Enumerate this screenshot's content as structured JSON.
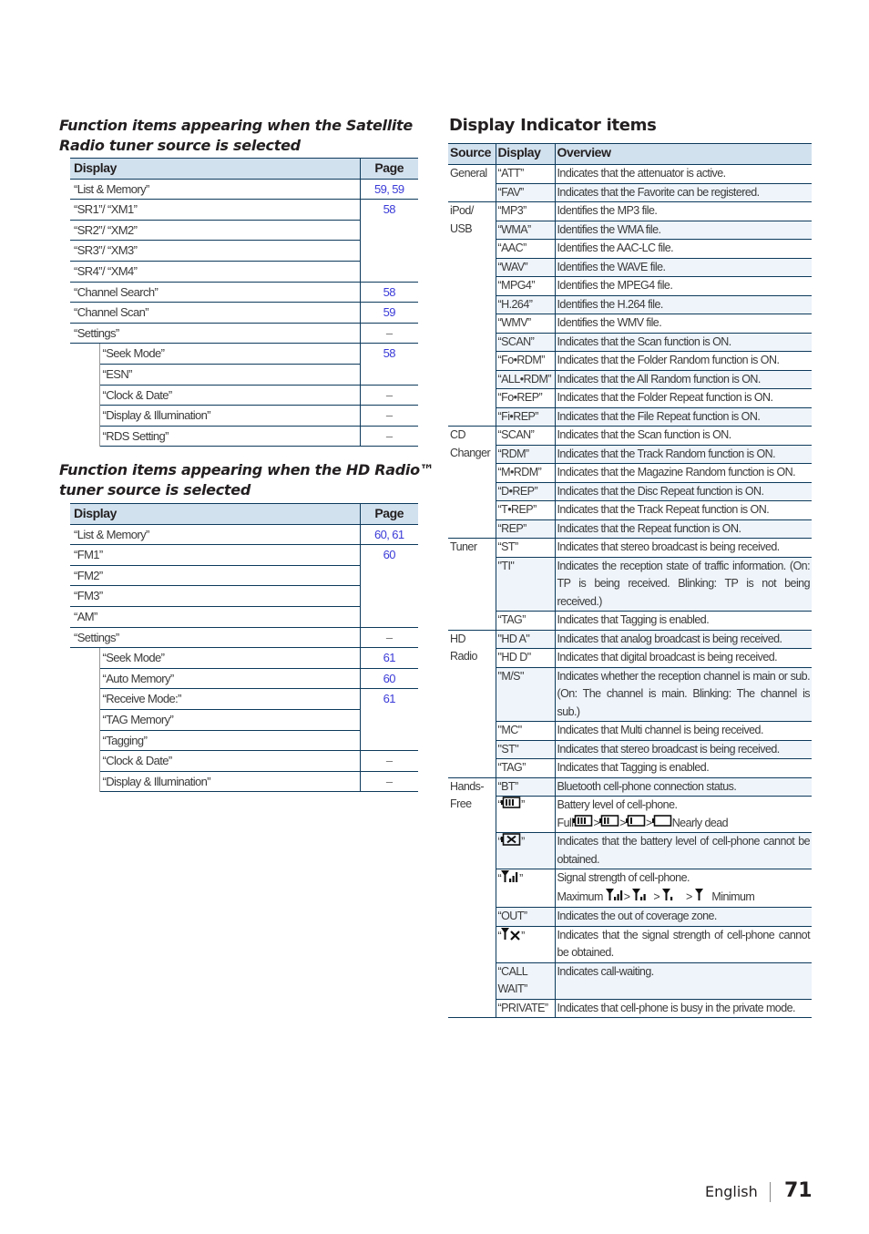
{
  "satellite_section": {
    "title_line1": "Function items appearing when the Satellite",
    "title_line2": "Radio tuner source is selected",
    "header": {
      "display": "Display",
      "page": "Page"
    },
    "rows": [
      {
        "display": "“List & Memory”",
        "page": "59, 59",
        "indent": false
      },
      {
        "display": "“SR1”/ “XM1”",
        "page": "58",
        "indent": false
      },
      {
        "display": "“SR2”/ “XM2”",
        "page": "",
        "indent": false
      },
      {
        "display": "“SR3”/ “XM3”",
        "page": "",
        "indent": false
      },
      {
        "display": "“SR4”/ “XM4”",
        "page": "",
        "indent": false
      },
      {
        "display": "“Channel Search”",
        "page": "58",
        "indent": false
      },
      {
        "display": "“Channel Scan”",
        "page": "59",
        "indent": false
      },
      {
        "display": "“Settings”",
        "page": "–",
        "indent": false
      },
      {
        "display": "“Seek Mode”",
        "page": "58",
        "indent": true
      },
      {
        "display": "“ESN”",
        "page": "",
        "indent": true
      },
      {
        "display": "“Clock & Date”",
        "page": "–",
        "indent": true
      },
      {
        "display": "“Display & Illumination”",
        "page": "–",
        "indent": true
      },
      {
        "display": "“RDS Setting”",
        "page": "–",
        "indent": true
      }
    ]
  },
  "hd_section": {
    "title_line1": "Function items appearing when the HD Radio™",
    "title_line2": "tuner source is selected",
    "header": {
      "display": "Display",
      "page": "Page"
    },
    "rows": [
      {
        "display": "“List & Memory”",
        "page": "60, 61",
        "indent": false
      },
      {
        "display": "“FM1”",
        "page": "60",
        "indent": false
      },
      {
        "display": "“FM2”",
        "page": "",
        "indent": false
      },
      {
        "display": "“FM3”",
        "page": "",
        "indent": false
      },
      {
        "display": "“AM”",
        "page": "",
        "indent": false
      },
      {
        "display": "“Settings”",
        "page": "–",
        "indent": false
      },
      {
        "display": "“Seek Mode”",
        "page": "61",
        "indent": true
      },
      {
        "display": "“Auto Memory”",
        "page": "60",
        "indent": true
      },
      {
        "display": "“Receive Mode:”",
        "page": "61",
        "indent": true
      },
      {
        "display": "“TAG Memory”",
        "page": "",
        "indent": true
      },
      {
        "display": "“Tagging”",
        "page": "",
        "indent": true
      },
      {
        "display": "“Clock & Date”",
        "page": "–",
        "indent": true
      },
      {
        "display": "“Display & Illumination”",
        "page": "–",
        "indent": true
      }
    ]
  },
  "indicator_section": {
    "title": "Display Indicator items",
    "header": {
      "source": "Source",
      "display": "Display",
      "overview": "Overview"
    },
    "rows": [
      {
        "source": "General",
        "display": "“ATT”",
        "overview": "Indicates that the attenuator is active."
      },
      {
        "source": "",
        "display": "“FAV”",
        "overview": "Indicates that the Favorite can be registered."
      },
      {
        "source": "iPod/ USB",
        "display": "“MP3”",
        "overview": "Identifies the MP3 file."
      },
      {
        "source": "",
        "display": "“WMA”",
        "overview": "Identifies the WMA file."
      },
      {
        "source": "",
        "display": "“AAC”",
        "overview": "Identifies the AAC-LC file."
      },
      {
        "source": "",
        "display": "“WAV”",
        "overview": "Identifies the WAVE file."
      },
      {
        "source": "",
        "display": "“MPG4”",
        "overview": "Identifies the MPEG4 file."
      },
      {
        "source": "",
        "display": "“H.264”",
        "overview": "Identifies the H.264 file."
      },
      {
        "source": "",
        "display": "“WMV”",
        "overview": "Identifies the WMV file."
      },
      {
        "source": "",
        "display": "“SCAN”",
        "overview": "Indicates that the Scan function is ON."
      },
      {
        "source": "",
        "display": "“Fo•RDM”",
        "overview": "Indicates that the Folder Random function is ON."
      },
      {
        "source": "",
        "display": "“ALL•RDM”",
        "overview": "Indicates that the All Random function is ON."
      },
      {
        "source": "",
        "display": "“Fo•REP”",
        "overview": "Indicates that the Folder Repeat function is ON."
      },
      {
        "source": "",
        "display": "“Fi•REP”",
        "overview": "Indicates that the File Repeat function is ON."
      },
      {
        "source": "CD Changer",
        "display": "“SCAN”",
        "overview": "Indicates that the Scan function is ON."
      },
      {
        "source": "",
        "display": "“RDM”",
        "overview": "Indicates that the Track Random function is ON."
      },
      {
        "source": "",
        "display": "“M•RDM”",
        "overview": "Indicates that the Magazine Random function is ON."
      },
      {
        "source": "",
        "display": "“D•REP”",
        "overview": "Indicates that the Disc Repeat function is ON."
      },
      {
        "source": "",
        "display": "“T•REP”",
        "overview": "Indicates that the Track Repeat function is ON."
      },
      {
        "source": "",
        "display": "“REP”",
        "overview": "Indicates that the Repeat function is ON."
      },
      {
        "source": "Tuner",
        "display": "“ST”",
        "overview": "Indicates that stereo broadcast is being received."
      },
      {
        "source": "",
        "display": "\"TI\"",
        "overview": "Indicates the reception state of traffic information. (On: TP is being received.  Blinking: TP is not being received.)"
      },
      {
        "source": "",
        "display": "“TAG”",
        "overview": "Indicates that Tagging is enabled."
      },
      {
        "source": "HD Radio",
        "display": "\"HD A\"",
        "overview": "Indicates that analog broadcast is being received."
      },
      {
        "source": "",
        "display": "\"HD D\"",
        "overview": "Indicates that digital broadcast is being received."
      },
      {
        "source": "",
        "display": "\"M/S\"",
        "overview": "Indicates whether the reception channel is main or sub. (On: The channel is main. Blinking: The channel is sub.)"
      },
      {
        "source": "",
        "display": "\"MC\"",
        "overview": "Indicates that Multi channel is being received."
      },
      {
        "source": "",
        "display": "\"ST\"",
        "overview": "Indicates that stereo broadcast is being received."
      },
      {
        "source": "",
        "display": "“TAG”",
        "overview": "Indicates that Tagging is enabled."
      },
      {
        "source": "Hands-Free",
        "display": "“BT”",
        "overview": "Bluetooth cell-phone connection status."
      },
      {
        "source": "",
        "display_icon": "battery-full-icon",
        "overview": "Battery level of cell-phone.",
        "overview_line2": {
          "full": "Full",
          "sep": ">",
          "dead": "Nearly dead"
        }
      },
      {
        "source": "",
        "display_icon": "battery-unknown-icon",
        "overview": "Indicates that the battery level of cell-phone cannot be obtained."
      },
      {
        "source": "",
        "display_icon": "signal-max-icon",
        "overview": "Signal strength of cell-phone.",
        "overview_line2": {
          "max": "Maximum",
          "sep": ">",
          "min": "Minimum"
        }
      },
      {
        "source": "",
        "display": "“OUT”",
        "overview": "Indicates the out of coverage zone."
      },
      {
        "source": "",
        "display_icon": "signal-unknown-icon",
        "overview": "Indicates that the signal strength of cell-phone cannot be obtained."
      },
      {
        "source": "",
        "display": "“CALL WAIT”",
        "overview": "Indicates call-waiting."
      },
      {
        "source": "",
        "display": "“PRIVATE”",
        "overview": "Indicates that cell-phone is busy in the private mode."
      }
    ]
  },
  "footer": {
    "language": "English",
    "page_number": "71"
  }
}
